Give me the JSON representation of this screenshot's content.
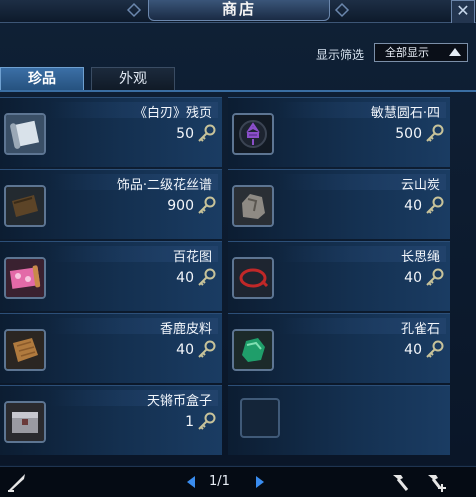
{
  "window": {
    "title": "商店",
    "close_glyph": "✕"
  },
  "filter": {
    "label": "显示筛选",
    "value": "全部显示"
  },
  "tabs": [
    {
      "label": "珍品",
      "active": true
    },
    {
      "label": "外观",
      "active": false
    }
  ],
  "items": [
    {
      "name": "《白刃》残页",
      "price": "50",
      "icon": "scroll-icon"
    },
    {
      "name": "敏慧圆石·四",
      "price": "500",
      "icon": "orb-stone-icon"
    },
    {
      "name": "饰品·二级花丝谱",
      "price": "900",
      "icon": "filigree-scroll-icon"
    },
    {
      "name": "云山炭",
      "price": "40",
      "icon": "charcoal-icon"
    },
    {
      "name": "百花图",
      "price": "40",
      "icon": "flower-scroll-icon"
    },
    {
      "name": "长思绳",
      "price": "40",
      "icon": "rope-icon"
    },
    {
      "name": "香鹿皮料",
      "price": "40",
      "icon": "leather-icon"
    },
    {
      "name": "孔雀石",
      "price": "40",
      "icon": "malachite-icon"
    },
    {
      "name": "天锵币盒子",
      "price": "1",
      "icon": "coin-box-icon"
    }
  ],
  "pagination": {
    "text": "1/1"
  },
  "colors": {
    "accent": "#3a8df0",
    "panel": "#143050",
    "background": "#0b1a2e"
  }
}
